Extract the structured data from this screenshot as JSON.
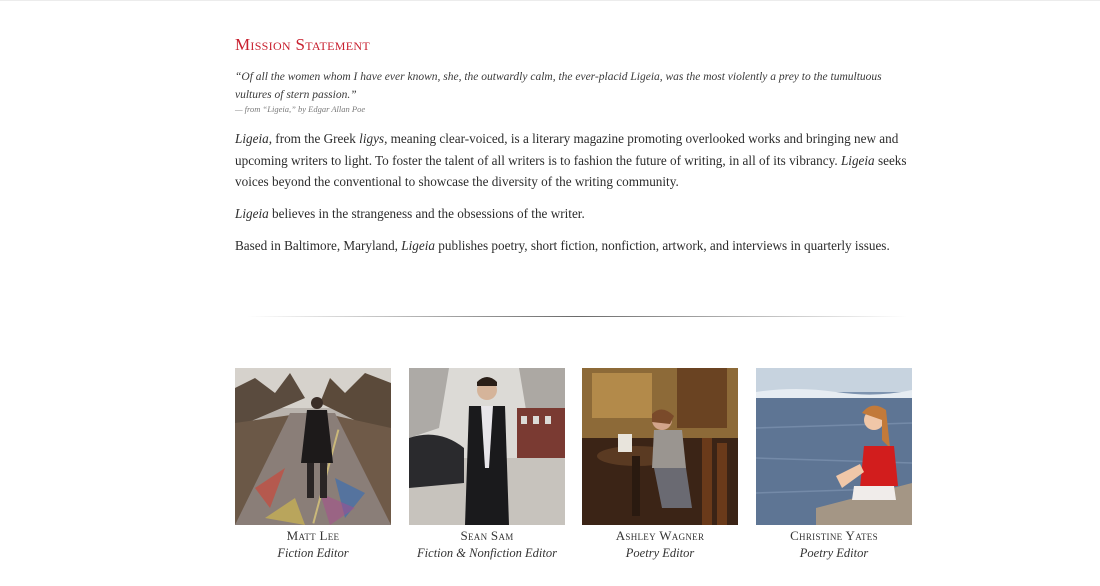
{
  "mission": {
    "title": "Mission Statement",
    "epigraph": "“Of all the women whom I have ever known, she, the outwardly calm, the ever-placid Ligeia, was the most violently a prey to the tumultuous vultures of stern passion.”",
    "attribution": "— from “Ligeia,” by Edgar Allan Poe",
    "paragraphs": {
      "p1": {
        "a": "Ligeia",
        "b": ", from the Greek ",
        "c": "ligys",
        "d": ", meaning clear-voiced, is a literary magazine promoting overlooked works and bringing new and upcoming writers to light. To foster the talent of all writers is to fashion the future of writing, in all of its vibrancy. ",
        "e": "Ligeia",
        "f": " seeks voices beyond the conventional to showcase the diversity of the writing community."
      },
      "p2": {
        "a": "Ligeia",
        "b": " believes in the strangeness and the obsessions of the writer."
      },
      "p3": {
        "a": "Based in Baltimore, Maryland, ",
        "b": "Ligeia",
        "c": " publishes poetry, short fiction, nonfiction, artwork, and interviews in quarterly issues."
      }
    }
  },
  "staff": [
    {
      "name": "Matt Lee",
      "role": "Fiction Editor"
    },
    {
      "name": "Sean Sam",
      "role": "Fiction & Nonfiction Editor"
    },
    {
      "name": "Ashley Wagner",
      "role": "Poetry Editor"
    },
    {
      "name": "Christine Yates",
      "role": "Poetry Editor"
    }
  ],
  "colors": {
    "accent": "#c8202f",
    "text": "#2b2b2b"
  }
}
